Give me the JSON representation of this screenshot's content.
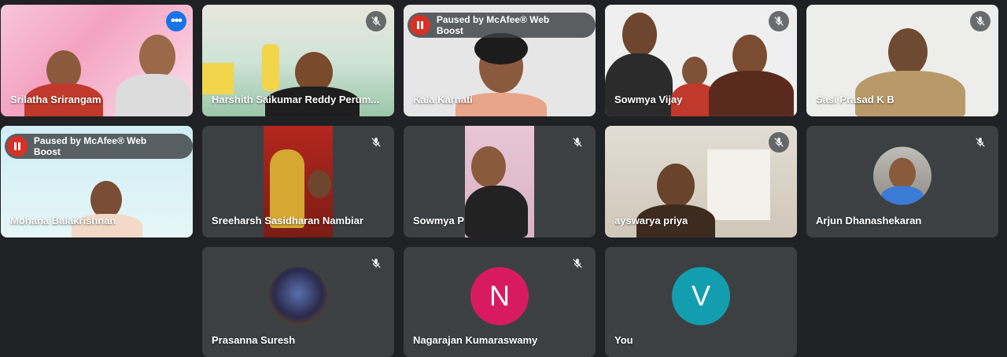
{
  "participants": [
    {
      "name": "Srilatha Srirangam",
      "more_label": "•••"
    },
    {
      "name": "Harshith Saikumar Reddy Perum..."
    },
    {
      "name": "Kala Karnati",
      "paused_text": "Paused by McAfee® Web Boost"
    },
    {
      "name": "Sowmya Vijay"
    },
    {
      "name": "Sasi Prasad K B"
    },
    {
      "name": "Mohana Balakrishnan",
      "paused_text": "Paused by McAfee® Web Boost"
    },
    {
      "name": "Sreeharsh Sasidharan Nambiar"
    },
    {
      "name": "Sowmya P"
    },
    {
      "name": "ayswarya priya"
    },
    {
      "name": "Arjun Dhanashekaran"
    },
    {
      "name": "Prasanna Suresh"
    },
    {
      "name": "Nagarajan Kumaraswamy",
      "initial": "N",
      "avatar_color": "#d81b60"
    },
    {
      "name": "You",
      "initial": "V",
      "avatar_color": "#129eaf"
    }
  ],
  "colors": {
    "background": "#202124",
    "tile": "#3c4043",
    "active_border": "#8ab4f8",
    "pause": "#d93025"
  }
}
